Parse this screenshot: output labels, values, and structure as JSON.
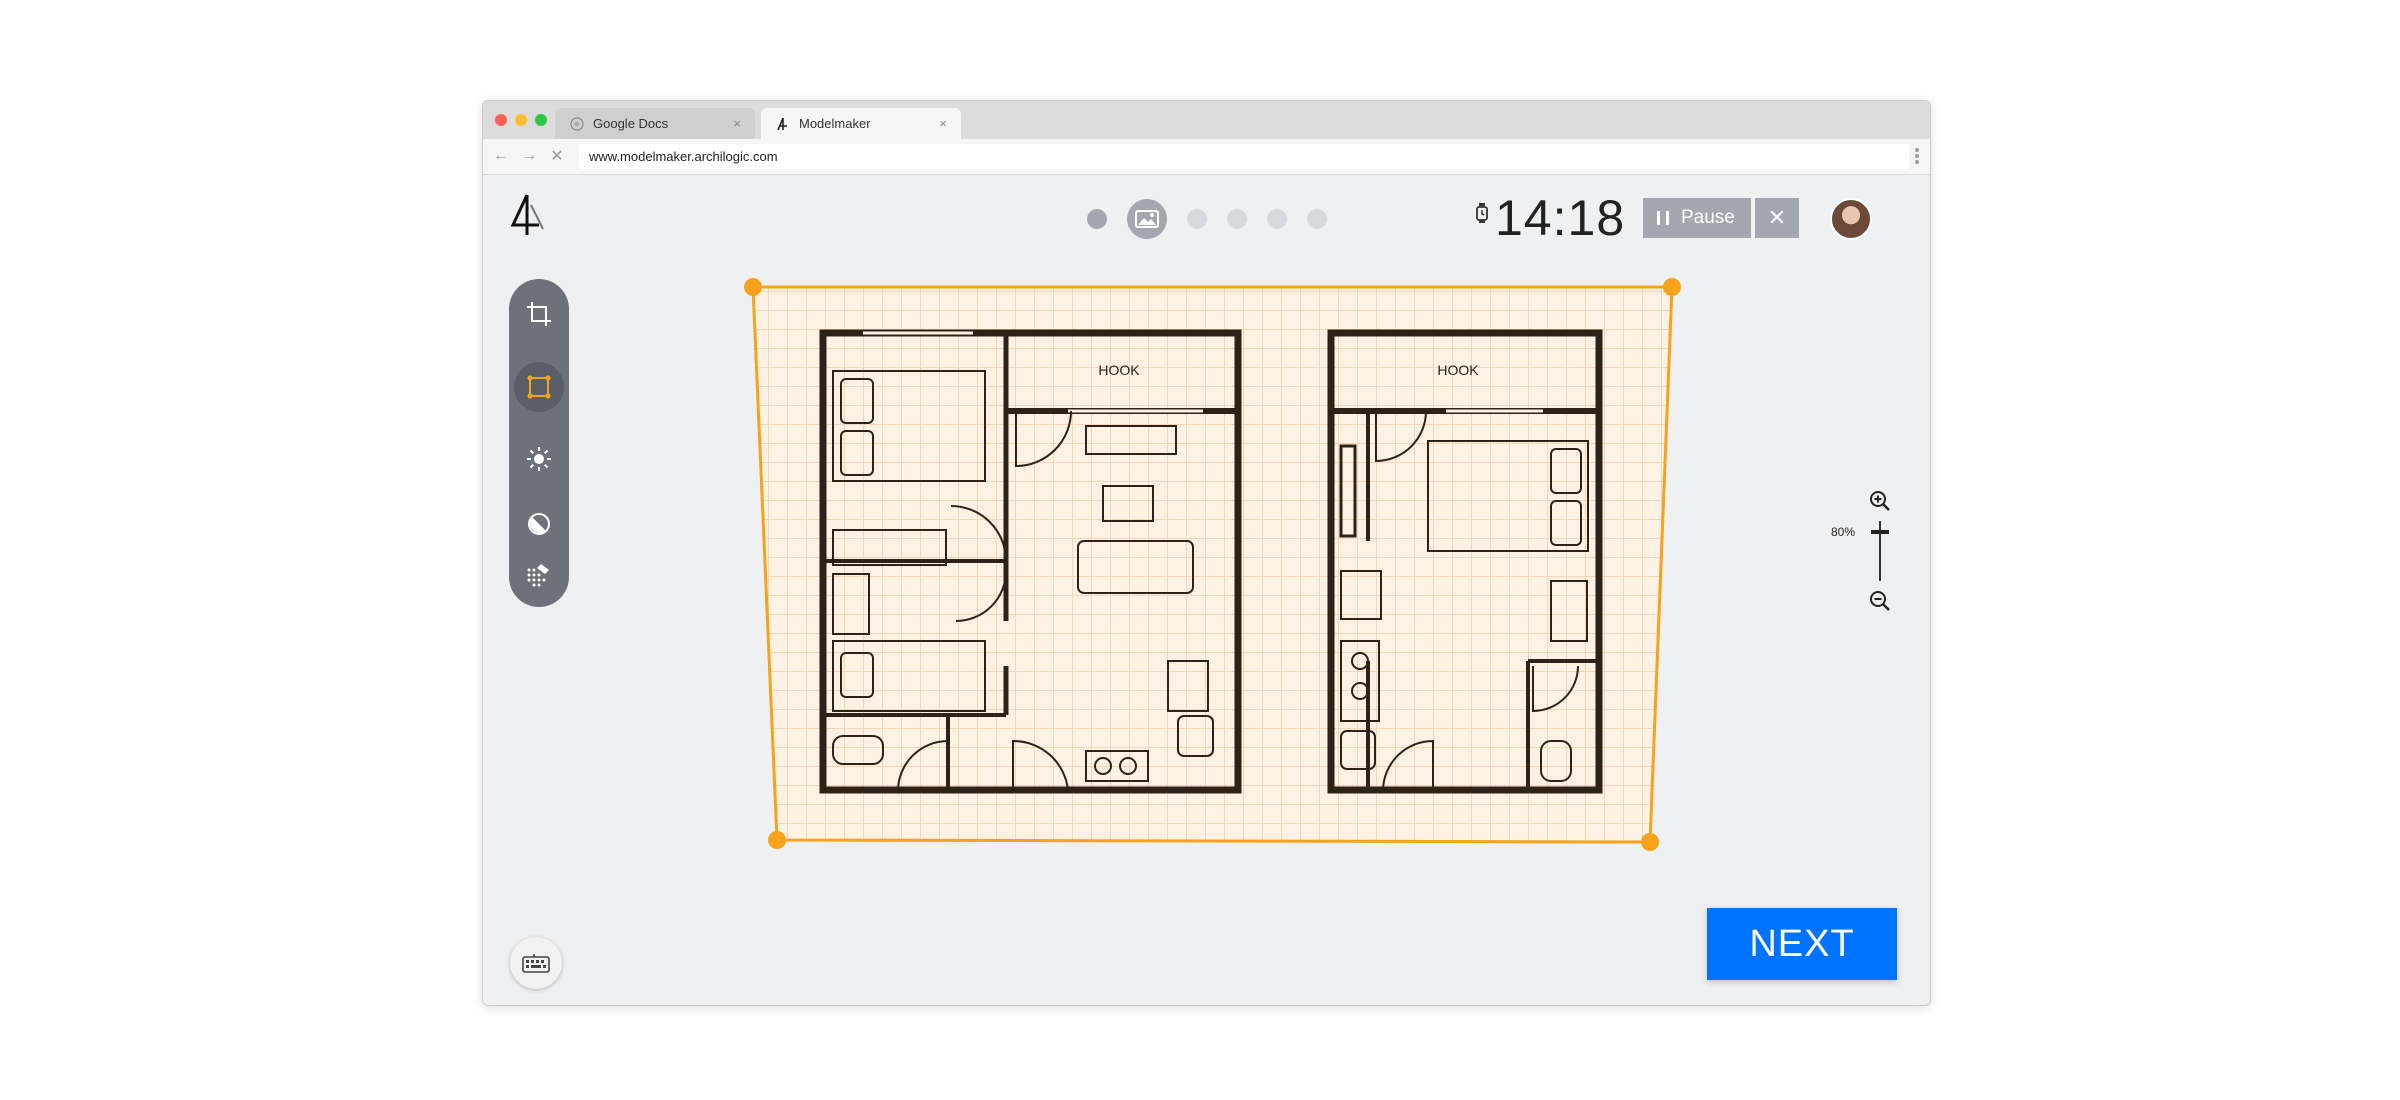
{
  "browser": {
    "tabs": [
      {
        "label": "Google Docs",
        "icon": "google-docs-icon",
        "active": false
      },
      {
        "label": "Modelmaker",
        "icon": "archilogic-logo-icon",
        "active": true
      }
    ],
    "close_glyph": "×",
    "url": "www.modelmaker.archilogic.com",
    "nav": {
      "back": "←",
      "forward": "→",
      "stop": "✕"
    }
  },
  "header": {
    "steps": [
      {
        "state": "done"
      },
      {
        "state": "current",
        "icon": "image-icon"
      },
      {
        "state": "pending"
      },
      {
        "state": "pending"
      },
      {
        "state": "pending"
      },
      {
        "state": "pending"
      }
    ],
    "timer": "14:18",
    "pause_label": "Pause",
    "close_glyph": "✕"
  },
  "toolbar": {
    "tools": [
      {
        "name": "crop-icon",
        "selected": false
      },
      {
        "name": "perspective-icon",
        "selected": true
      },
      {
        "name": "brightness-icon",
        "selected": false
      },
      {
        "name": "contrast-icon",
        "selected": false
      },
      {
        "name": "pattern-icon",
        "selected": false
      }
    ]
  },
  "floorplan": {
    "room_labels": [
      "HOOK",
      "HOOK"
    ]
  },
  "zoom": {
    "level": "80%"
  },
  "footer": {
    "next_label": "NEXT"
  },
  "colors": {
    "accent_orange": "#f7a21b",
    "next_blue": "#0073ff",
    "control_grey": "#a2a7b0",
    "toolbar_grey": "#6d717a"
  }
}
